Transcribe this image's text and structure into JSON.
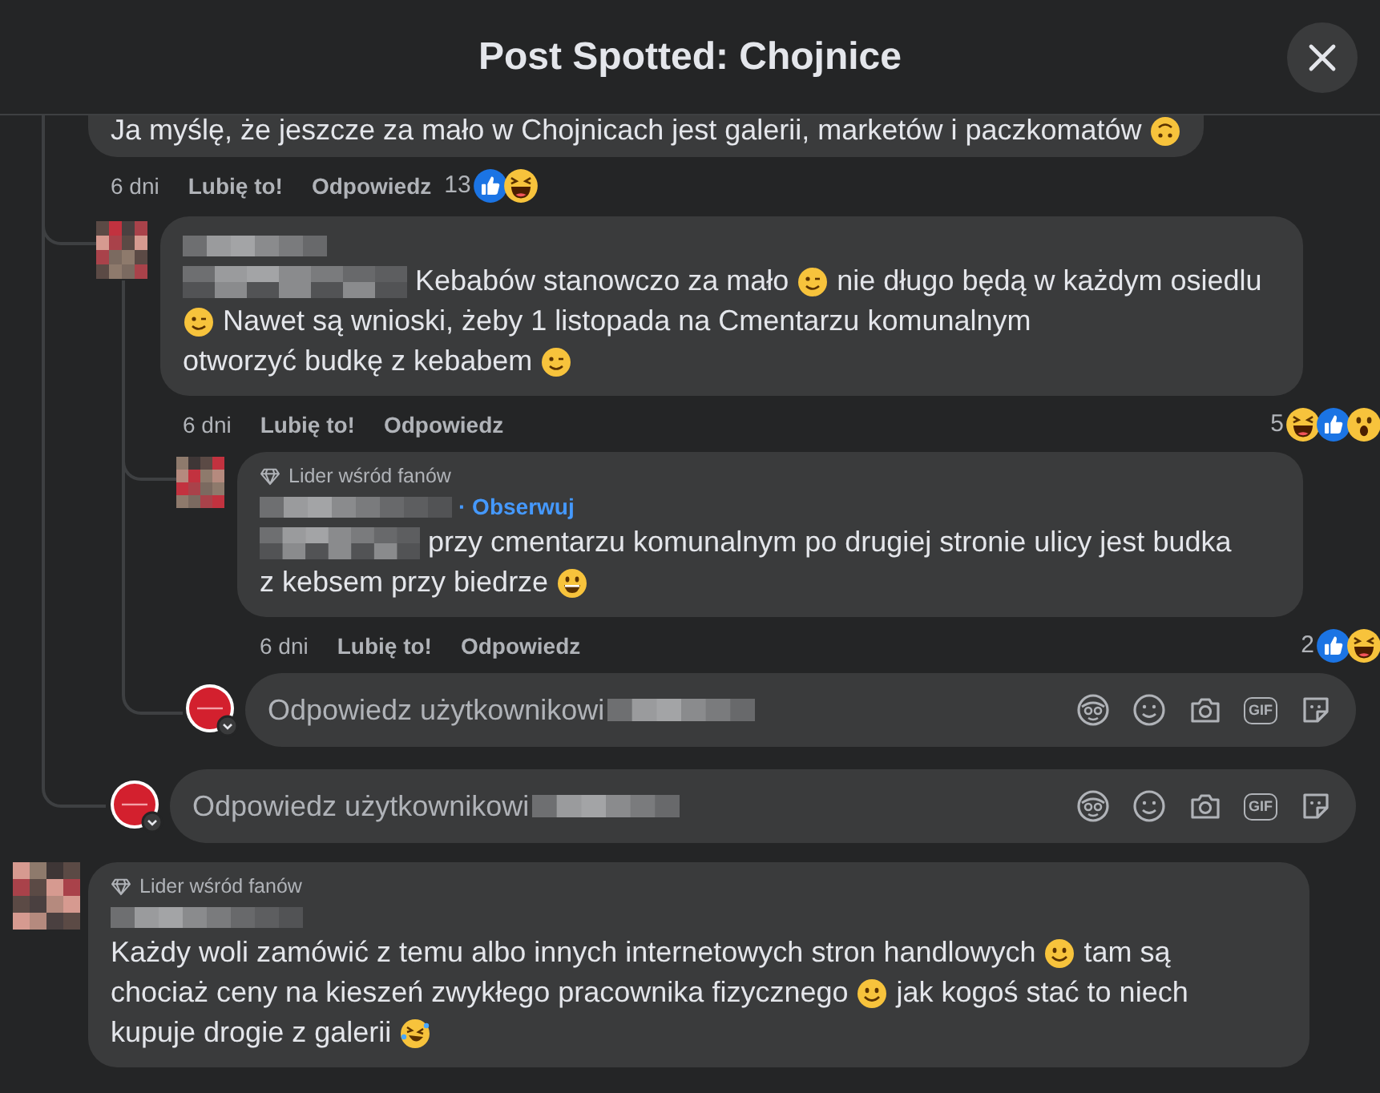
{
  "dialog": {
    "title": "Post Spotted: Chojnice"
  },
  "comments": [
    {
      "body": [
        {
          "kind": "text",
          "text": "Ja myślę, że jeszcze za mało w Chojnicach jest galerii, marketów i paczkomatów"
        },
        {
          "kind": "upside"
        }
      ],
      "time": "6 dni",
      "like": "Lubię to!",
      "reply": "Odpowiedz",
      "reaction_count": "13",
      "reactions": [
        {
          "kind": "like"
        },
        {
          "kind": "haha"
        }
      ],
      "replies": [
        {
          "author_hidden": true,
          "body": [
            {
              "kind": "blur"
            },
            {
              "kind": "text",
              "text": "Kebabów stanowczo za mało"
            },
            {
              "kind": "wink"
            },
            {
              "kind": "text",
              "text": "nie długo będą w każdym"
            },
            {
              "kind": "text",
              "text": "osiedlu"
            },
            {
              "kind": "wink"
            },
            {
              "kind": "text",
              "text": "Nawet są wnioski, żeby 1 listopada na Cmentarzu komunalnym"
            },
            {
              "kind": "text",
              "text": "otworzyć budkę z kebabem"
            },
            {
              "kind": "wink"
            }
          ],
          "time": "6 dni",
          "like": "Lubię to!",
          "reply": "Odpowiedz",
          "reaction_count": "5",
          "reactions": [
            {
              "kind": "haha"
            },
            {
              "kind": "like"
            },
            {
              "kind": "wow"
            }
          ],
          "replies": [
            {
              "badge": "Lider wśród fanów",
              "author_hidden": true,
              "follow": "· Obserwuj",
              "body": [
                {
                  "kind": "blur"
                },
                {
                  "kind": "text",
                  "text": "przy cmentarzu komunalnym po drugiej stronie ulicy jest budka"
                },
                {
                  "kind": "text",
                  "text": "z kebsem przy biedrze"
                },
                {
                  "kind": "grin"
                }
              ],
              "time": "6 dni",
              "like": "Lubię to!",
              "reply": "Odpowiedz",
              "reaction_count": "2",
              "reactions": [
                {
                  "kind": "like"
                },
                {
                  "kind": "haha"
                }
              ]
            }
          ],
          "reply_field": {
            "placeholder": "Odpowiedz użytkownikowi",
            "name_hidden": true,
            "gif_label": "GIF"
          }
        }
      ],
      "reply_field": {
        "placeholder": "Odpowiedz użytkownikowi",
        "name_hidden": true,
        "gif_label": "GIF"
      }
    },
    {
      "badge": "Lider wśród fanów",
      "author_hidden": true,
      "body": [
        {
          "kind": "text",
          "text": "Każdy woli zamówić z temu albo innych internetowych stron handlowych"
        },
        {
          "kind": "smile"
        },
        {
          "kind": "text",
          "text": "tam są"
        },
        {
          "kind": "text",
          "text": "chociaż ceny na kieszeń zwykłego pracownika fizycznego"
        },
        {
          "kind": "smile"
        },
        {
          "kind": "text",
          "text": "jak kogoś stać to niech"
        },
        {
          "kind": "text",
          "text": "kupuje drogie z galerii"
        },
        {
          "kind": "rofl"
        }
      ]
    }
  ]
}
